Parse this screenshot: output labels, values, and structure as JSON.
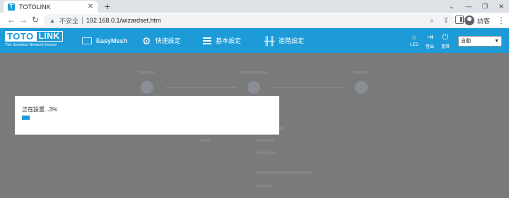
{
  "browser": {
    "tab_title": "TOTOLINK",
    "favicon_letter": "T",
    "insecure_label": "不安全",
    "url": "192.168.0.1/wizardset.htm",
    "profile_label": "訪客"
  },
  "header": {
    "logo_toto": "TOTO",
    "logo_link": "LINK",
    "logo_tagline": "The Smartest Network Device",
    "nav": {
      "easymesh": "EasyMesh",
      "quick_setup": "快速設定",
      "basic_setup": "基本設定",
      "advanced_setup": "進階設定"
    },
    "buttons": {
      "led": "LED",
      "logout": "登出",
      "reboot": "重啓"
    },
    "language_selected": "自動"
  },
  "dialog": {
    "status_text": "正在設置...3%",
    "progress_percent": 3
  },
  "colors": {
    "brand_blue": "#1d9bd8",
    "overlay_gray": "#7a7a7a"
  },
  "icons": {
    "back": "arrow-left-icon",
    "forward": "arrow-right-icon",
    "reload": "reload-icon",
    "warning": "warning-icon",
    "zoom": "magnifier-icon",
    "share": "share-icon",
    "side_panel": "side-panel-icon",
    "profile": "profile-icon",
    "menu": "menu-dots-icon",
    "easymesh": "mesh-icon",
    "quick_setup": "gear-icon",
    "basic_setup": "list-icon",
    "advanced_setup": "sliders-icon",
    "led": "led-icon",
    "logout": "logout-icon",
    "reboot": "power-icon"
  }
}
